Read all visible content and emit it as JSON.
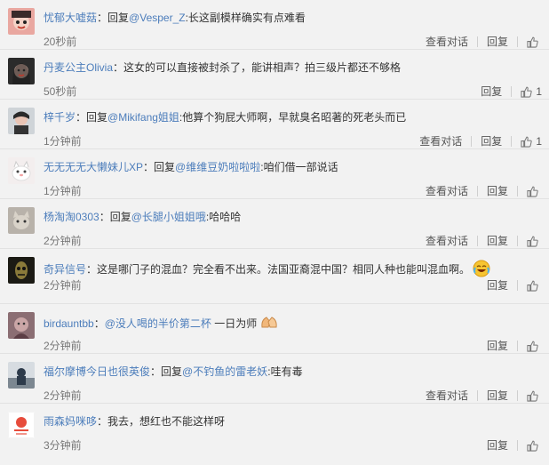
{
  "actions": {
    "view_conversation": "查看对话",
    "reply": "回复"
  },
  "comments": [
    {
      "user": "忧郁大嘘菇",
      "reply_word": "回复",
      "at": "@Vesper_Z",
      "text": ":长这副模样确实有点难看",
      "time": "20秒前",
      "has_view": true,
      "likes": ""
    },
    {
      "user": "丹麦公主Olivia",
      "reply_word": "",
      "at": "",
      "text": "这女的可以直接被封杀了，能讲相声？拍三级片都还不够格",
      "time": "50秒前",
      "has_view": false,
      "likes": "1"
    },
    {
      "user": "梓千岁",
      "reply_word": "回复",
      "at": "@Mikifang姐姐",
      "text": ":他算个狗屁大师啊，早就臭名昭著的死老头而已",
      "time": "1分钟前",
      "has_view": true,
      "likes": "1"
    },
    {
      "user": "无无无无大懒妹儿XP",
      "reply_word": "回复",
      "at": "@维维豆奶啦啦啦",
      "text": ":咱们借一部说话",
      "time": "1分钟前",
      "has_view": true,
      "likes": ""
    },
    {
      "user": "杨淘淘0303",
      "reply_word": "回复",
      "at": "@长腿小姐姐哦",
      "text": ":哈哈哈",
      "time": "2分钟前",
      "has_view": true,
      "likes": ""
    },
    {
      "user": "奇异信号",
      "reply_word": "",
      "at": "",
      "text": "这是哪门子的混血？完全看不出来。法国亚裔混中国？相同人种也能叫混血啊。",
      "time": "2分钟前",
      "has_view": false,
      "likes": ""
    },
    {
      "user": "birdauntbb",
      "reply_word": "",
      "at": "@没人喝的半价第二杯",
      "text": " 一日为师",
      "time": "2分钟前",
      "has_view": false,
      "likes": ""
    },
    {
      "user": "福尔摩博今日也很英俊",
      "reply_word": "回复",
      "at": "@不钓鱼的雷老妖",
      "text": ":哇有毒",
      "time": "2分钟前",
      "has_view": true,
      "likes": ""
    },
    {
      "user": "雨森妈咪哆",
      "reply_word": "",
      "at": "",
      "text": "我去，想红也不能这样呀",
      "time": "3分钟前",
      "has_view": false,
      "likes": ""
    }
  ],
  "icons": {
    "like": "thumbs-up-icon",
    "emoji_laugh_cry": "laugh-cry-emoji-icon",
    "emoji_clap": "clap-hands-emoji-icon"
  },
  "colors": {
    "username": "#4c7dbb",
    "background": "#f2f2f2"
  }
}
